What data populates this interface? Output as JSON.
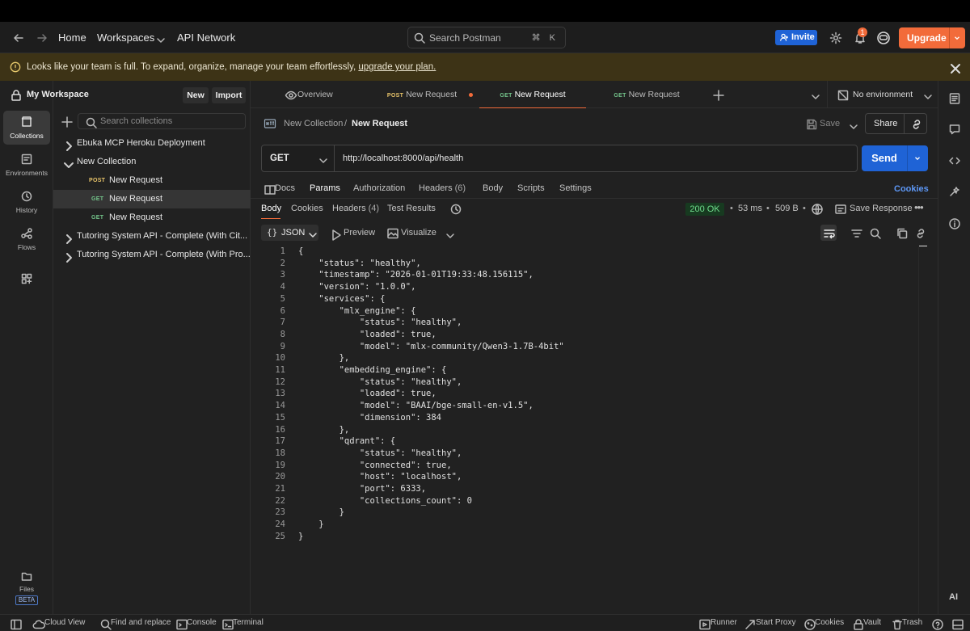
{
  "topbar": {
    "home": "Home",
    "workspaces": "Workspaces",
    "api_network": "API Network",
    "search_placeholder": "Search Postman",
    "search_shortcut": "⌘ K",
    "invite": "Invite",
    "notifications_count": "1",
    "upgrade": "Upgrade"
  },
  "banner": {
    "text": "Looks like your team is full. To expand, organize, manage your team effortlessly,",
    "link": "upgrade your plan."
  },
  "rail": {
    "collections": "Collections",
    "environments": "Environments",
    "history": "History",
    "flows": "Flows",
    "files": "Files",
    "beta": "BETA"
  },
  "sidebar": {
    "workspace": "My Workspace",
    "new": "New",
    "import": "Import",
    "search_placeholder": "Search collections",
    "tree": [
      {
        "label": "Ebuka MCP Heroku Deployment"
      },
      {
        "label": "New Collection"
      },
      {
        "method": "POST",
        "label": "New Request"
      },
      {
        "method": "GET",
        "label": "New Request"
      },
      {
        "method": "GET",
        "label": "New Request"
      },
      {
        "label": "Tutoring System API - Complete (With Cit..."
      },
      {
        "label": "Tutoring System API - Complete (With Pro..."
      }
    ]
  },
  "tabs": {
    "overview": "Overview",
    "tab1_method": "POST",
    "tab1_label": "New Request",
    "tab2_method": "GET",
    "tab2_label": "New Request",
    "tab3_method": "GET",
    "tab3_label": "New Request",
    "environment": "No environment"
  },
  "request": {
    "breadcrumb_collection": "New Collection",
    "breadcrumb_sep": "/",
    "breadcrumb_request": "New Request",
    "save": "Save",
    "share": "Share",
    "method": "GET",
    "url": "http://localhost:8000/api/health",
    "send": "Send",
    "tabs": {
      "docs": "Docs",
      "params": "Params",
      "authorization": "Authorization",
      "headers": "Headers",
      "headers_count": "(6)",
      "body": "Body",
      "scripts": "Scripts",
      "settings": "Settings",
      "cookies": "Cookies"
    }
  },
  "response": {
    "tabs": {
      "body": "Body",
      "cookies": "Cookies",
      "headers": "Headers",
      "headers_count": "(4)",
      "test_results": "Test Results"
    },
    "status": "200 OK",
    "time": "53 ms",
    "size": "509 B",
    "save_response": "Save Response",
    "format": "JSON",
    "preview": "Preview",
    "visualize": "Visualize",
    "lines": [
      "{",
      "    \"status\": \"healthy\",",
      "    \"timestamp\": \"2026-01-01T19:33:48.156115\",",
      "    \"version\": \"1.0.0\",",
      "    \"services\": {",
      "        \"mlx_engine\": {",
      "            \"status\": \"healthy\",",
      "            \"loaded\": true,",
      "            \"model\": \"mlx-community/Qwen3-1.7B-4bit\"",
      "        },",
      "        \"embedding_engine\": {",
      "            \"status\": \"healthy\",",
      "            \"loaded\": true,",
      "            \"model\": \"BAAI/bge-small-en-v1.5\",",
      "            \"dimension\": 384",
      "        },",
      "        \"qdrant\": {",
      "            \"status\": \"healthy\",",
      "            \"connected\": true,",
      "            \"host\": \"localhost\",",
      "            \"port\": 6333,",
      "            \"collections_count\": 0",
      "        }",
      "    }",
      "}"
    ]
  },
  "statusbar": {
    "cloud_view": "Cloud View",
    "find_replace": "Find and replace",
    "console": "Console",
    "terminal": "Terminal",
    "runner": "Runner",
    "start_proxy": "Start Proxy",
    "cookies": "Cookies",
    "vault": "Vault",
    "trash": "Trash"
  },
  "colors": {
    "accent": "#f26b3a",
    "primary": "#1f63d6",
    "status_ok": "#6fdc8c"
  }
}
